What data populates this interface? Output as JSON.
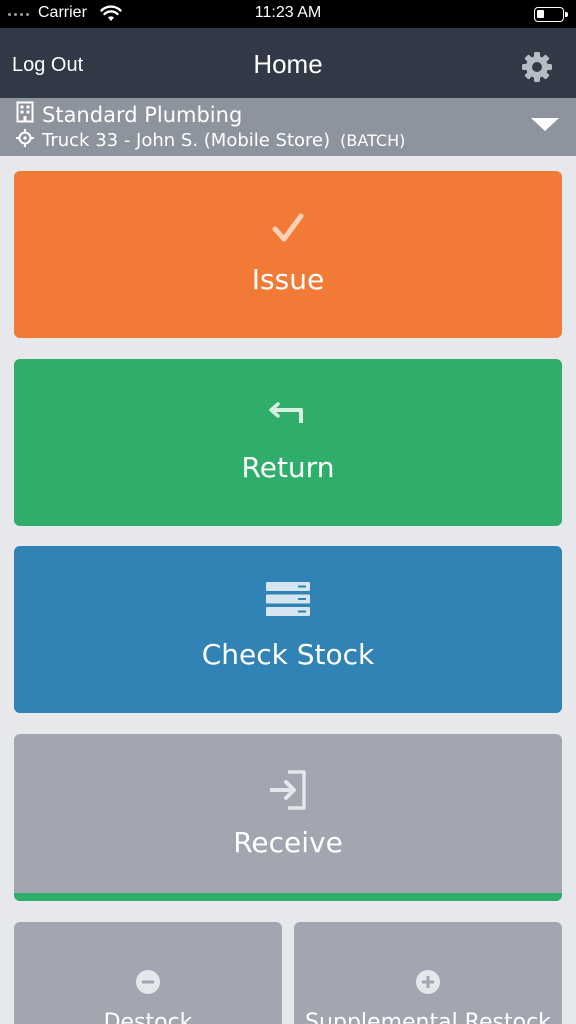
{
  "status_bar": {
    "carrier": "Carrier",
    "time": "11:23 AM",
    "battery_level": 0.25
  },
  "nav": {
    "logout_label": "Log Out",
    "title": "Home",
    "settings_icon": "gear-icon"
  },
  "context": {
    "company_icon": "building-icon",
    "company": "Standard Plumbing",
    "location_icon": "crosshair-icon",
    "location": "Truck 33 - John S. (Mobile Store)",
    "mode": "(BATCH)",
    "dropdown_icon": "caret-down-icon"
  },
  "tiles": [
    {
      "label": "Issue",
      "icon": "checkmark-icon",
      "color": "#f17b36"
    },
    {
      "label": "Return",
      "icon": "return-arrow-icon",
      "color": "#2fae6b"
    },
    {
      "label": "Check Stock",
      "icon": "stack-icon",
      "color": "#3182b5"
    },
    {
      "label": "Receive",
      "icon": "sign-in-icon",
      "color": "#a1a6b1",
      "accent_bar_color": "#2fae6b"
    }
  ],
  "half_tiles": [
    {
      "label": "Destock",
      "icon": "minus-circle-icon"
    },
    {
      "label": "Supplemental Restock",
      "icon": "plus-circle-icon"
    }
  ]
}
